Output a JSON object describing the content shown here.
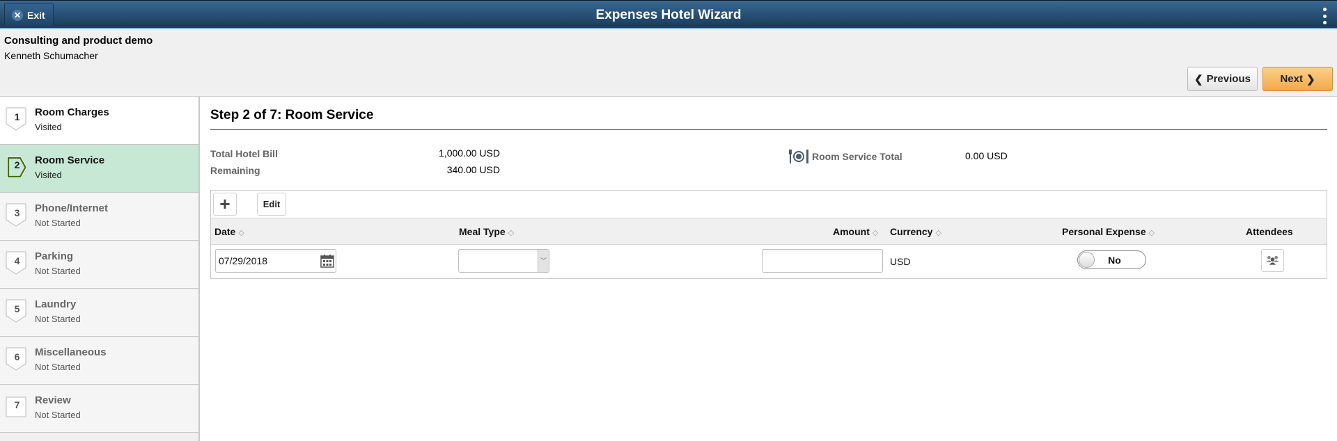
{
  "header": {
    "exit_label": "Exit",
    "title": "Expenses Hotel Wizard",
    "menu_icon": "kebab-menu-icon"
  },
  "context": {
    "title": "Consulting and product demo",
    "user": "Kenneth Schumacher"
  },
  "nav": {
    "previous_label": "Previous",
    "next_label": "Next"
  },
  "steps": [
    {
      "num": "1",
      "label": "Room Charges",
      "status": "Visited",
      "state": "visited"
    },
    {
      "num": "2",
      "label": "Room Service",
      "status": "Visited",
      "state": "current"
    },
    {
      "num": "3",
      "label": "Phone/Internet",
      "status": "Not Started",
      "state": "notstarted"
    },
    {
      "num": "4",
      "label": "Parking",
      "status": "Not Started",
      "state": "notstarted"
    },
    {
      "num": "5",
      "label": "Laundry",
      "status": "Not Started",
      "state": "notstarted"
    },
    {
      "num": "6",
      "label": "Miscellaneous",
      "status": "Not Started",
      "state": "notstarted"
    },
    {
      "num": "7",
      "label": "Review",
      "status": "Not Started",
      "state": "notstarted"
    }
  ],
  "main": {
    "step_title": "Step 2 of 7: Room Service",
    "summary": {
      "total_label": "Total Hotel Bill",
      "total_value": "1,000.00 USD",
      "remaining_label": "Remaining",
      "remaining_value": "340.00 USD",
      "rs_total_label": "Room Service Total",
      "rs_total_value": "0.00 USD"
    },
    "grid": {
      "add_label": "+",
      "edit_label": "Edit",
      "columns": {
        "date": "Date",
        "meal_type": "Meal Type",
        "amount": "Amount",
        "currency": "Currency",
        "personal_expense": "Personal Expense",
        "attendees": "Attendees"
      },
      "rows": [
        {
          "date": "07/29/2018",
          "meal_type": "",
          "amount": "",
          "currency": "USD",
          "personal_expense": "No"
        }
      ]
    }
  },
  "colors": {
    "header_top": "#386894",
    "header_bottom": "#1a3a57",
    "current_step_bg": "#c7e8d4",
    "current_step_border": "#4a6b14",
    "next_button": "#f3a949"
  }
}
